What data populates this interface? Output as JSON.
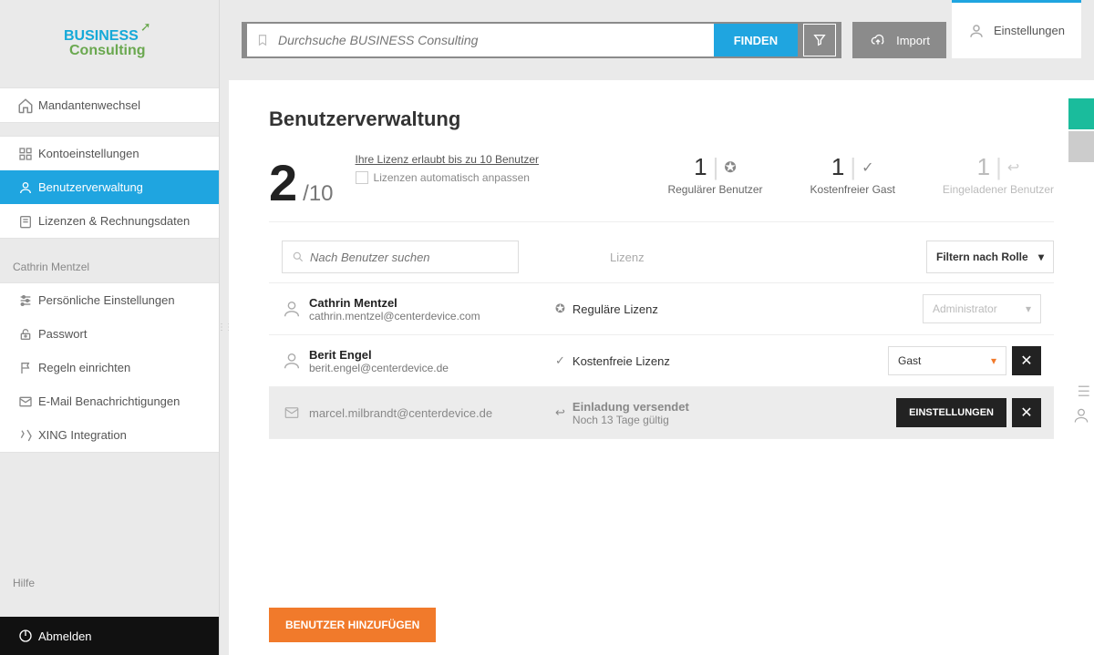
{
  "logo": {
    "line1": "BUSINESS",
    "line2": "Consulting"
  },
  "sidebar": {
    "tenant_switch": "Mandantenwechsel",
    "account_settings": "Kontoeinstellungen",
    "user_management": "Benutzerverwaltung",
    "licenses_billing": "Lizenzen & Rechnungsdaten",
    "user_header": "Cathrin Mentzel",
    "personal_settings": "Persönliche Einstellungen",
    "password": "Passwort",
    "rules": "Regeln einrichten",
    "email_notifications": "E-Mail Benachrichtigungen",
    "xing": "XING Integration",
    "help": "Hilfe",
    "logout": "Abmelden"
  },
  "topbar": {
    "search_placeholder": "Durchsuche BUSINESS Consulting",
    "find": "FINDEN",
    "import": "Import",
    "settings": "Einstellungen"
  },
  "page": {
    "title": "Benutzerverwaltung",
    "count_used": "2",
    "count_total": "/10",
    "license_text": "Ihre Lizenz erlaubt bis zu 10 Benutzer",
    "auto_adjust": "Lizenzen automatisch anpassen",
    "stats": {
      "regular_num": "1",
      "regular_label": "Regulärer Benutzer",
      "guest_num": "1",
      "guest_label": "Kostenfreier Gast",
      "invited_num": "1",
      "invited_label": "Eingeladener Benutzer"
    },
    "search_user_placeholder": "Nach Benutzer suchen",
    "license_col": "Lizenz",
    "role_filter": "Filtern nach Rolle"
  },
  "users": {
    "u1": {
      "name": "Cathrin Mentzel",
      "email": "cathrin.mentzel@centerdevice.com",
      "license": "Reguläre Lizenz",
      "role": "Administrator"
    },
    "u2": {
      "name": "Berit Engel",
      "email": "berit.engel@centerdevice.de",
      "license": "Kostenfreie Lizenz",
      "role": "Gast"
    },
    "u3": {
      "email": "marcel.milbrandt@centerdevice.de",
      "status1": "Einladung versendet",
      "status2": "Noch 13 Tage gültig",
      "settings_btn": "EINSTELLUNGEN"
    }
  },
  "add_user_btn": "BENUTZER HINZUFÜGEN"
}
